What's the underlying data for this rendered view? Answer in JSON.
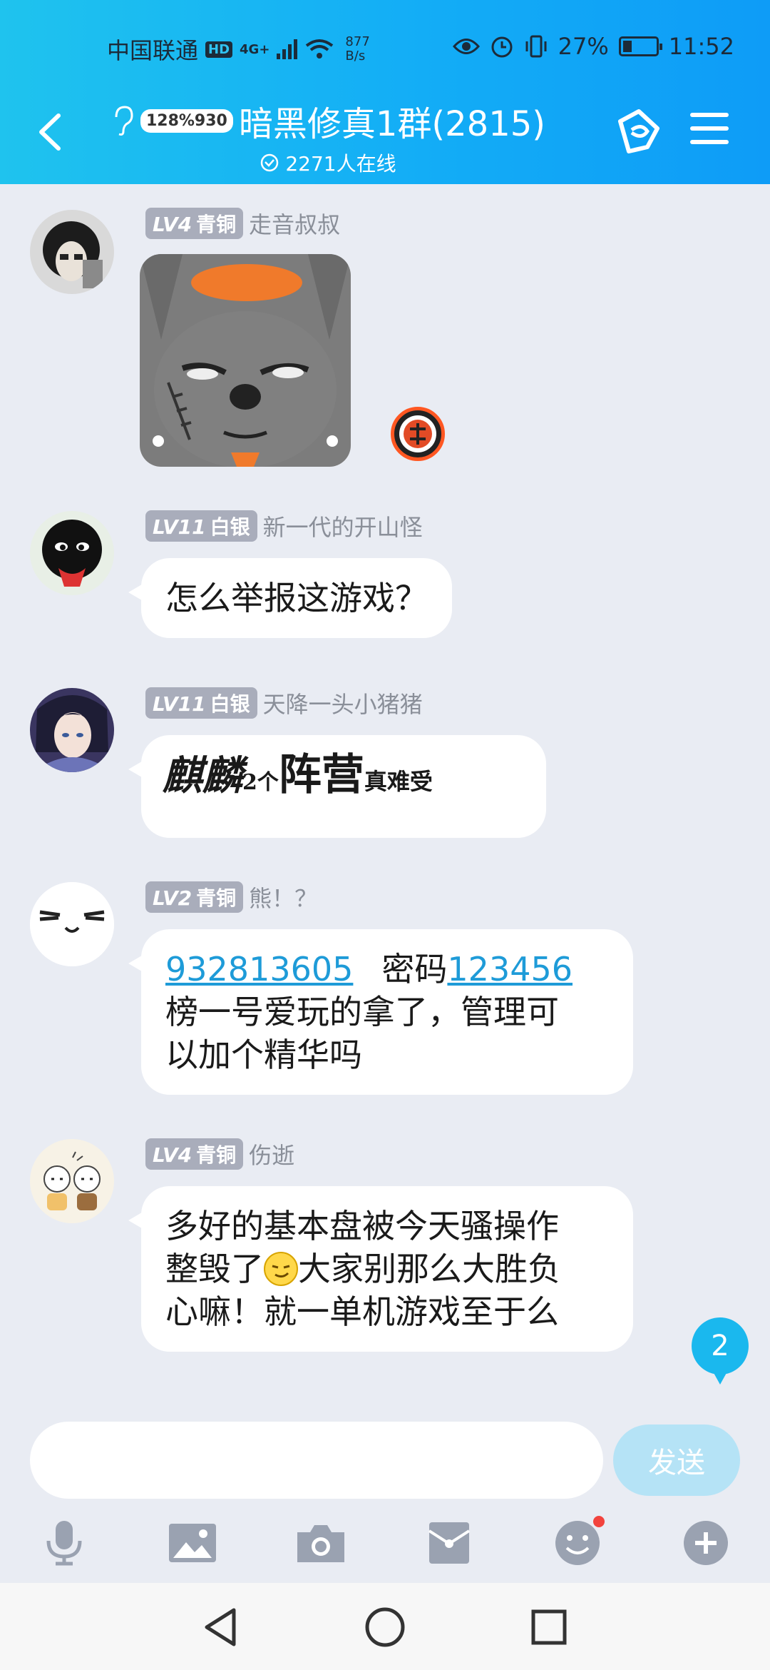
{
  "status_bar": {
    "carrier": "中国联通",
    "hd": "HD",
    "network": "4G+",
    "speed_value": "877",
    "speed_unit": "B/s",
    "battery": "27%",
    "time": "11:52"
  },
  "header": {
    "badge": "128%930",
    "title": "暗黑修真1群(2815)",
    "online": "2271人在线"
  },
  "messages": [
    {
      "level": "LV4",
      "rank": "青铜",
      "name": "走音叔叔",
      "type": "sticker"
    },
    {
      "level": "LV11",
      "rank": "白银",
      "name": "新一代的开山怪",
      "text": "怎么举报这游戏？"
    },
    {
      "level": "LV11",
      "rank": "白银",
      "name": "天降一头小猪猪",
      "art": {
        "w1": "麒麟",
        "w2": "2个",
        "w3": "阵营",
        "w4": "真难受"
      }
    },
    {
      "level": "LV2",
      "rank": "青铜",
      "name": "熊！？",
      "link1": "932813605",
      "mid": "密码",
      "link2": "123456",
      "line2": "榜一号爱玩的拿了，管理可",
      "line3": "以加个精华吗"
    },
    {
      "level": "LV4",
      "rank": "青铜",
      "name": "伤逝",
      "line1": "多好的基本盘被今天骚操作",
      "line2a": "整毁了",
      "line2b": "大家别那么大胜负",
      "line3": "心嘛！就一单机游戏至于么"
    }
  ],
  "unread_count": "2",
  "input": {
    "placeholder": "",
    "send_label": "发送"
  },
  "colors": {
    "accent": "#13adf6",
    "background": "#e9ecf3",
    "link": "#1e9bd8"
  }
}
